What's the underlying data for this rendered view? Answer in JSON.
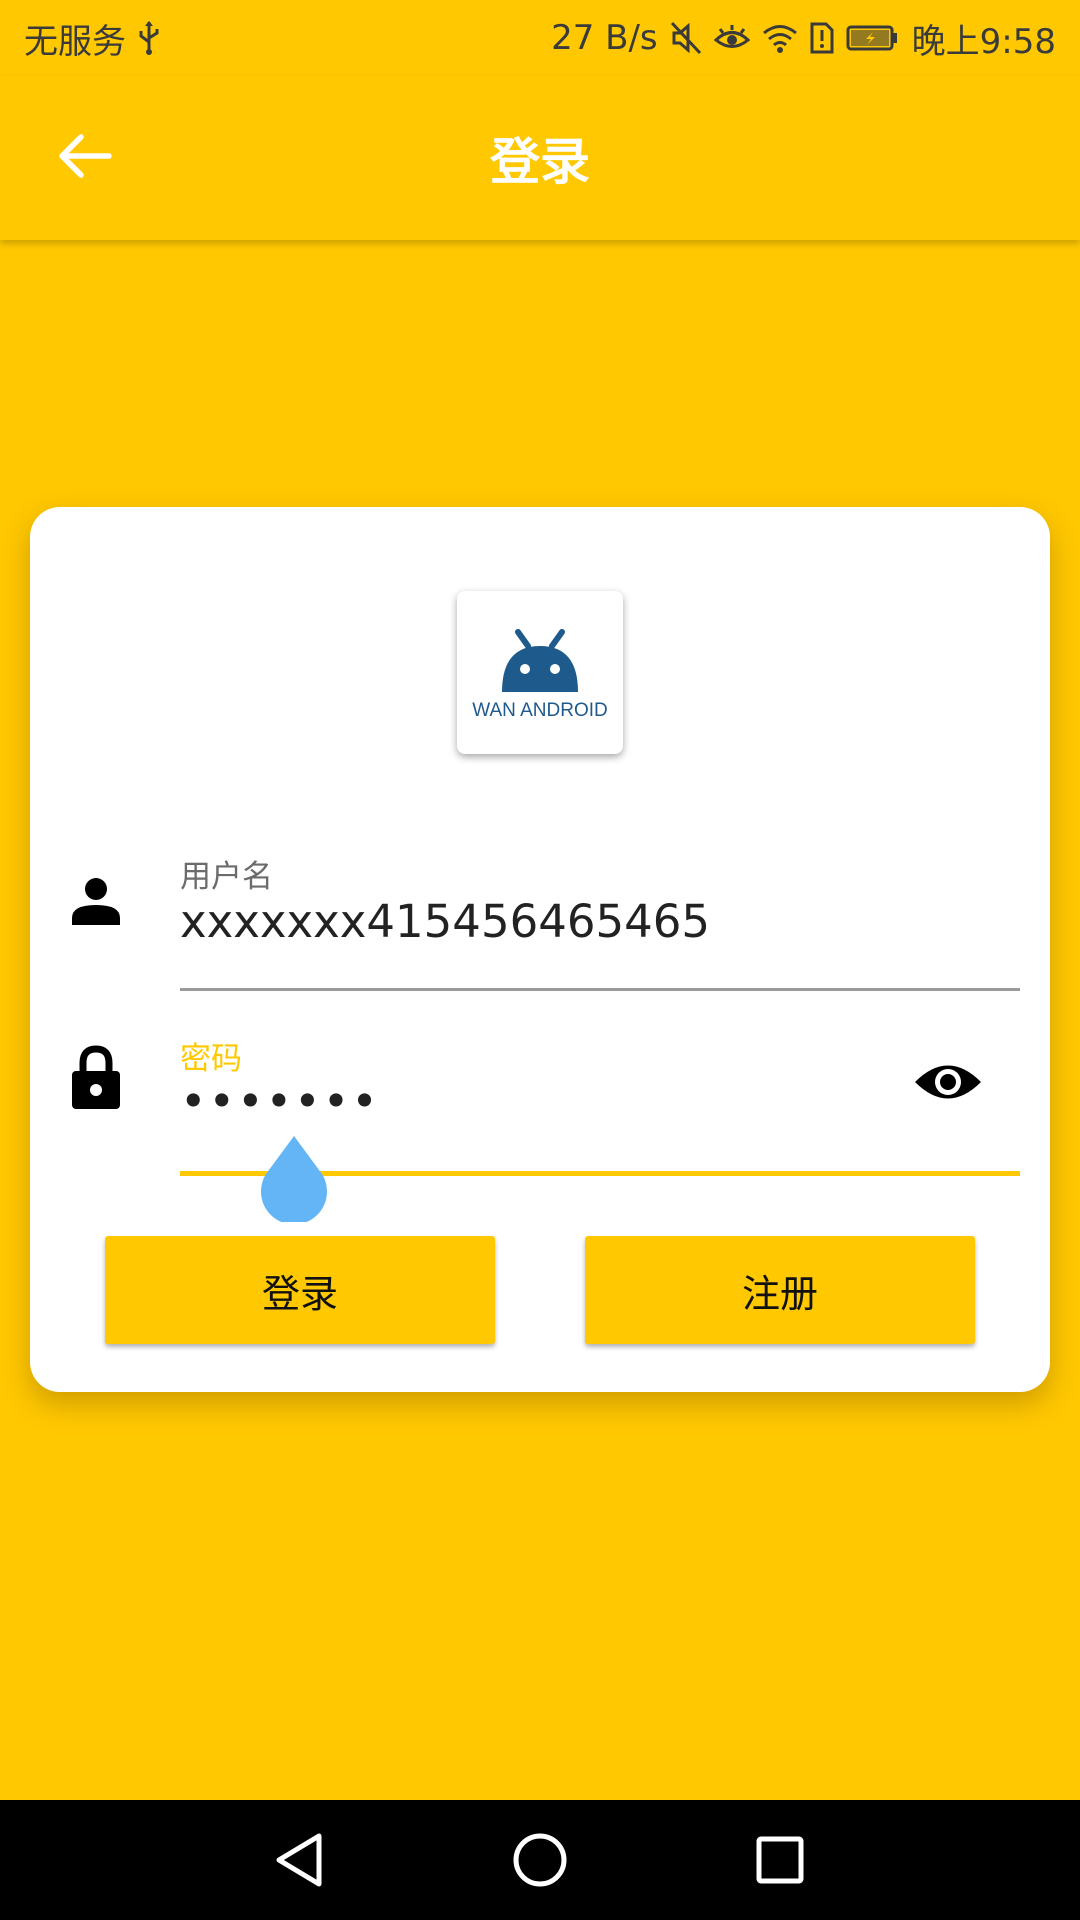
{
  "status_bar": {
    "carrier": "无服务",
    "net_speed": "27 B/s",
    "time": "晚上9:58",
    "icons": [
      "usb-icon",
      "mute-icon",
      "eye-comfort-icon",
      "wifi-icon",
      "sim-alert-icon",
      "battery-icon"
    ]
  },
  "app_bar": {
    "title": "登录",
    "back_icon": "arrow-left-icon"
  },
  "logo": {
    "text": "WAN ANDROID",
    "brand_color": "#1F5A8C"
  },
  "form": {
    "username": {
      "label": "用户名",
      "value": "xxxxxxx415456465465",
      "icon": "person-icon"
    },
    "password": {
      "label": "密码",
      "value": "•••••••",
      "icon": "lock-icon",
      "toggle_icon": "eye-icon"
    }
  },
  "buttons": {
    "login": "登录",
    "register": "注册"
  },
  "colors": {
    "accent": "#FFC800",
    "card": "#FFFFFF",
    "cursor_handle": "#64B5F6"
  },
  "nav_bar": {
    "icons": [
      "back-triangle-icon",
      "home-circle-icon",
      "recents-square-icon"
    ]
  }
}
